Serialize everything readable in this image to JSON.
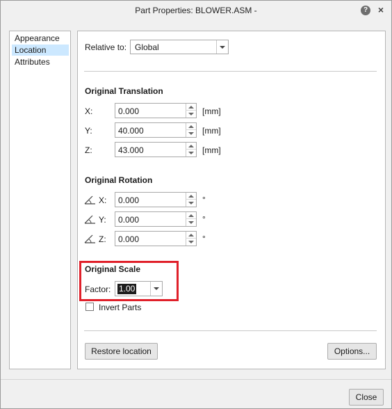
{
  "window": {
    "title": "Part Properties: BLOWER.ASM -"
  },
  "titlebar": {
    "help_icon": "question-mark-icon",
    "help_glyph": "?",
    "close_icon": "close-x-icon",
    "close_glyph": "×"
  },
  "sidebar": {
    "items": [
      {
        "label": "Appearance",
        "active": false
      },
      {
        "label": "Location",
        "active": true
      },
      {
        "label": "Attributes",
        "active": false
      }
    ]
  },
  "relative_to": {
    "label": "Relative to:",
    "value": "Global"
  },
  "translation": {
    "heading": "Original Translation",
    "rows": [
      {
        "axis": "X:",
        "value": "0.000",
        "unit": "[mm]"
      },
      {
        "axis": "Y:",
        "value": "40.000",
        "unit": "[mm]"
      },
      {
        "axis": "Z:",
        "value": "43.000",
        "unit": "[mm]"
      }
    ]
  },
  "rotation": {
    "heading": "Original Rotation",
    "rows": [
      {
        "axis": "X:",
        "value": "0.000",
        "unit": "°"
      },
      {
        "axis": "Y:",
        "value": "0.000",
        "unit": "°"
      },
      {
        "axis": "Z:",
        "value": "0.000",
        "unit": "°"
      }
    ]
  },
  "scale": {
    "heading": "Original Scale",
    "factor_label": "Factor:",
    "factor_value": "1.00"
  },
  "invert": {
    "label": "Invert Parts",
    "checked": false
  },
  "buttons": {
    "restore": "Restore location",
    "options": "Options...",
    "close": "Close"
  },
  "colors": {
    "highlight": "#e0202a",
    "selection": "#cce8ff"
  }
}
